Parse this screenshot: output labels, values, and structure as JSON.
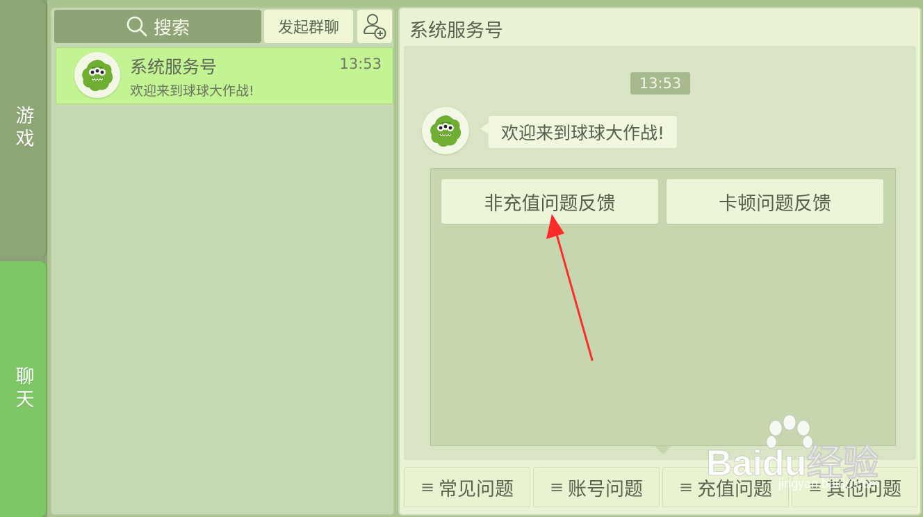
{
  "sidebar": {
    "tabs": [
      {
        "label": "游戏",
        "active": false
      },
      {
        "label": "聊天",
        "active": true
      }
    ]
  },
  "conversation_list": {
    "search_label": "搜索",
    "group_chat_label": "发起群聊",
    "items": [
      {
        "name": "系统服务号",
        "preview": "欢迎来到球球大作战!",
        "time": "13:53",
        "selected": true
      }
    ]
  },
  "chat": {
    "title": "系统服务号",
    "timestamp": "13:53",
    "message": "欢迎来到球球大作战!",
    "menu_options": [
      "非充值问题反馈",
      "卡顿问题反馈"
    ],
    "bottom_menu": [
      "常见问题",
      "账号问题",
      "充值问题",
      "其他问题"
    ]
  },
  "watermark": {
    "brand": "Baidu经验",
    "url": "jingyan.baidu.com"
  },
  "colors": {
    "active_tab": "#7dc767",
    "selected_item": "#c3f393",
    "annotation_arrow": "#ff2b2b"
  },
  "icons": [
    "search-icon",
    "add-user-icon",
    "menu-lines-icon",
    "monster-avatar"
  ]
}
